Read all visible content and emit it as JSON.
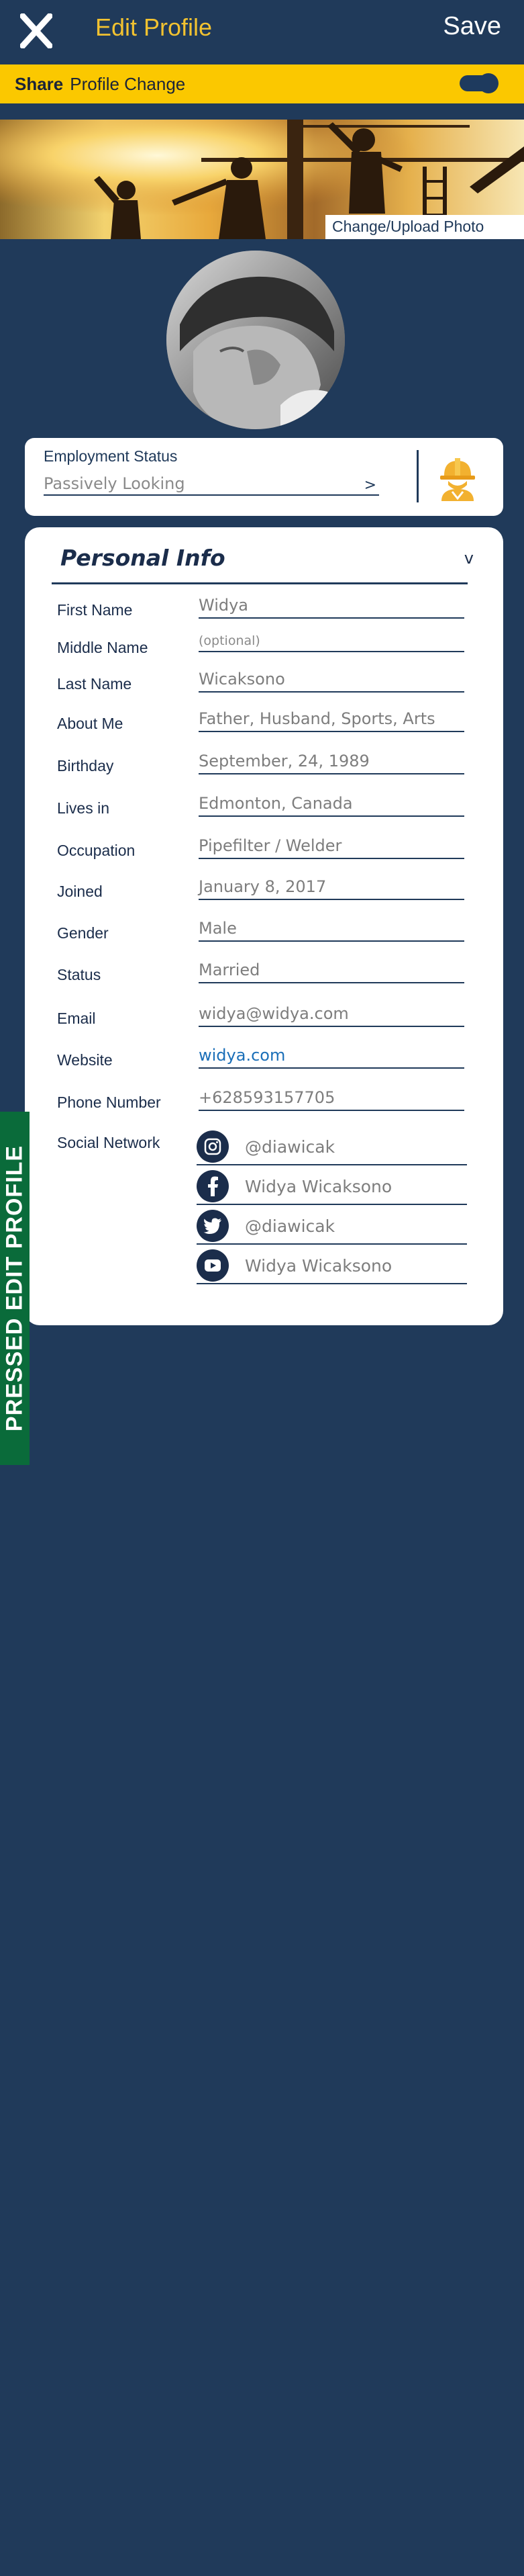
{
  "header": {
    "close_icon": "close-x-icon",
    "title": "Edit Profile",
    "save_label": "Save"
  },
  "share_bar": {
    "label_bold": "Share",
    "label": "Profile Change",
    "toggle_on": true
  },
  "banner": {
    "upload_label": "Change/Upload Photo"
  },
  "employment": {
    "label": "Employment Status",
    "value": "Passively Looking",
    "arrow": ">",
    "icon": "worker-helmet-icon"
  },
  "personal_info": {
    "title": "Personal Info",
    "chevron": "v",
    "fields": [
      {
        "label": "First Name",
        "value": "Widya"
      },
      {
        "label": "Middle Name",
        "value": "(optional)"
      },
      {
        "label": "Last Name",
        "value": "Wicaksono"
      },
      {
        "label": "About Me",
        "value": "Father, Husband, Sports, Arts"
      },
      {
        "label": "Birthday",
        "value": "September, 24, 1989"
      },
      {
        "label": "Lives in",
        "value": "Edmonton, Canada"
      },
      {
        "label": "Occupation",
        "value": "Pipefilter / Welder"
      },
      {
        "label": "Joined",
        "value": "January 8, 2017"
      },
      {
        "label": "Gender",
        "value": "Male"
      },
      {
        "label": "Status",
        "value": "Married"
      },
      {
        "label": "Email",
        "value": "widya@widya.com"
      },
      {
        "label": "Website",
        "value": "widya.com"
      },
      {
        "label": "Phone Number",
        "value": "+628593157705"
      }
    ],
    "social_label": "Social Network",
    "social": [
      {
        "icon": "instagram-icon",
        "value": "@diawicak"
      },
      {
        "icon": "facebook-icon",
        "value": "Widya Wicaksono"
      },
      {
        "icon": "twitter-icon",
        "value": "@diawicak"
      },
      {
        "icon": "youtube-icon",
        "value": "Widya Wicaksono"
      }
    ]
  },
  "side_tab": {
    "label": "PRESSED EDIT PROFILE"
  },
  "colors": {
    "background": "#203a5a",
    "accent_yellow": "#fbc800",
    "title_yellow": "#f2c230",
    "side_tab_green": "#0a6b3a",
    "link_blue": "#1b6fb8"
  }
}
